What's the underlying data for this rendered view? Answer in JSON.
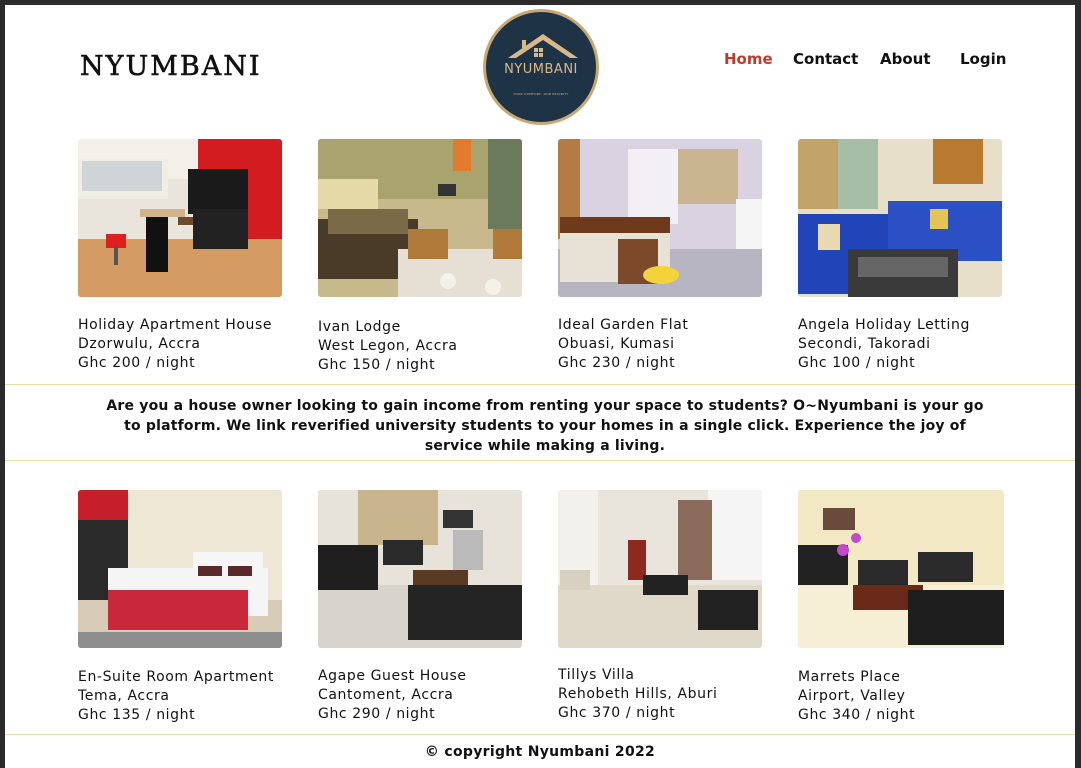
{
  "header": {
    "brand": "NYUMBANI",
    "logo_text": "NYUMBANI",
    "logo_tagline": "YOUR COMFORT, OUR PRIORITY",
    "nav": [
      {
        "label": "Home",
        "active": true
      },
      {
        "label": "Contact",
        "active": false
      },
      {
        "label": "About",
        "active": false
      },
      {
        "label": "Login",
        "active": false
      }
    ]
  },
  "listings": [
    {
      "name": "Holiday Apartment House",
      "location": "Dzorwulu, Accra",
      "price": "Ghc 200 / night"
    },
    {
      "name": "Ivan Lodge",
      "location": "West Legon, Accra",
      "price": "Ghc 150 / night"
    },
    {
      "name": "Ideal Garden Flat",
      "location": "Obuasi, Kumasi",
      "price": "Ghc 230 / night"
    },
    {
      "name": "Angela Holiday Letting",
      "location": "Secondi, Takoradi",
      "price": "Ghc 100 / night"
    },
    {
      "name": "En-Suite Room Apartment",
      "location": "Tema, Accra",
      "price": "Ghc 135 / night"
    },
    {
      "name": "Agape Guest House",
      "location": "Cantoment, Accra",
      "price": "Ghc 290 / night"
    },
    {
      "name": "Tillys Villa",
      "location": "Rehobeth Hills, Aburi",
      "price": "Ghc 370 / night"
    },
    {
      "name": "Marrets Place",
      "location": "Airport, Valley",
      "price": "Ghc 340 / night"
    }
  ],
  "blurb": "Are you a house owner looking to gain income from renting your space to students? O~Nyumbani is your go to platform. We link reverified university students to your homes in a single click. Experience the joy of service while making a living.",
  "footer": "© copyright Nyumbani 2022",
  "colors": {
    "accent": "#c0392b",
    "logo_bg": "#1f3346",
    "logo_gold": "#c7a873",
    "divider": "#ecd9a6"
  }
}
